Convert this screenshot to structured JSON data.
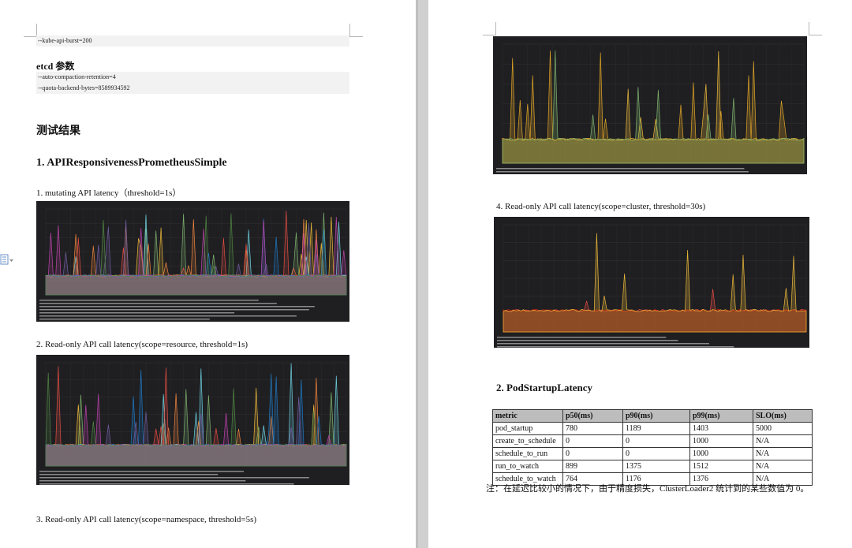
{
  "left_page": {
    "kube_line": "--kube-api-burst=200",
    "etcd_heading": "etcd 参数",
    "etcd_lines": [
      "--auto-compaction-retention=4",
      "--quota-backend-bytes=8589934592"
    ],
    "results_heading": "测试结果",
    "section1_heading": "1.  APIResponsivenessPrometheusSimple",
    "item1": "1.  mutating API latency（threshold=1s）",
    "item2": "2.  Read-only API call latency(scope=resource, threshold=1s)",
    "item3": "3.  Read-only API call latency(scope=namespace, threshold=5s)"
  },
  "right_page": {
    "item4": "4.  Read-only API call latency(scope=cluster, threshold=30s)",
    "section2_heading": "2.  PodStartupLatency",
    "table": {
      "headers": [
        "metric",
        "p50(ms)",
        "p90(ms)",
        "p99(ms)",
        "SLO(ms)"
      ],
      "rows": [
        [
          "pod_startup",
          "780",
          "1189",
          "1403",
          "5000"
        ],
        [
          "create_to_schedule",
          "0",
          "0",
          "1000",
          "N/A"
        ],
        [
          "schedule_to_run",
          "0",
          "0",
          "1000",
          "N/A"
        ],
        [
          "run_to_watch",
          "899",
          "1375",
          "1512",
          "N/A"
        ],
        [
          "schedule_to_watch",
          "764",
          "1176",
          "1376",
          "N/A"
        ]
      ]
    },
    "note": "注：在延迟比较小的情况下，由于精度损失，ClusterLoader2 统计到的某些数值为 0。"
  },
  "charts": {
    "mutating": {
      "background": "#1f1f22",
      "colors": [
        "#7eb26d",
        "#eab839",
        "#6ed0e0",
        "#ef843c",
        "#e24d42",
        "#1f78c1",
        "#ba43a9",
        "#705da0",
        "#508642"
      ]
    },
    "resource": {
      "background": "#1f1f22",
      "colors": [
        "#7eb26d",
        "#eab839",
        "#6ed0e0",
        "#ef843c",
        "#e24d42",
        "#1f78c1",
        "#ba43a9",
        "#705da0",
        "#508642"
      ]
    },
    "namespace": {
      "background": "#1f1f22",
      "colors": [
        "#eab839",
        "#e0a526",
        "#7eb26d"
      ]
    },
    "cluster": {
      "background": "#1f1f22",
      "colors": [
        "#e24d42",
        "#bf1b00",
        "#eab839"
      ]
    }
  }
}
